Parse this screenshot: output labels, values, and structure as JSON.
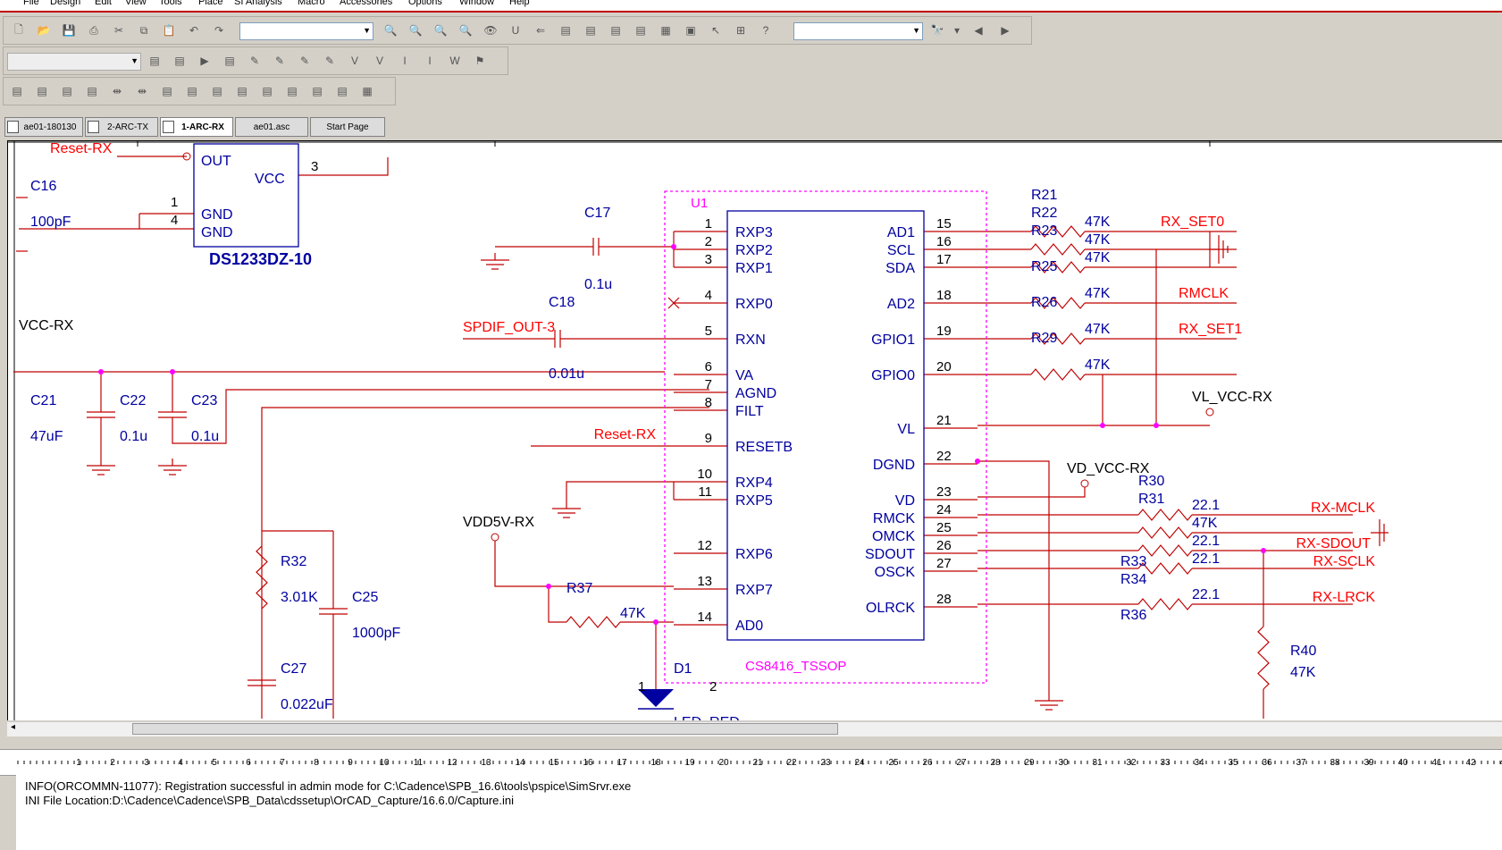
{
  "menu": [
    "File",
    "Design",
    "Edit",
    "View",
    "Tools",
    "Place",
    "SI Analysis",
    "Macro",
    "Accessories",
    "Options",
    "Window",
    "Help"
  ],
  "tabs": [
    {
      "label": "ae01-180130",
      "active": false
    },
    {
      "label": "2-ARC-TX",
      "active": false
    },
    {
      "label": "1-ARC-RX",
      "active": true
    },
    {
      "label": "ae01.asc",
      "active": false
    },
    {
      "label": "Start Page",
      "active": false
    }
  ],
  "toolbar": {
    "search_icon": "binoculars-icon",
    "help_icon": "help-icon"
  },
  "schematic": {
    "ic_u1": {
      "ref": "U1",
      "part": "CS8416_TSSOP",
      "left_pins": [
        [
          "1",
          "RXP3"
        ],
        [
          "2",
          "RXP2"
        ],
        [
          "3",
          "RXP1"
        ],
        [
          "4",
          "RXP0"
        ],
        [
          "5",
          "RXN"
        ],
        [
          "6",
          "VA"
        ],
        [
          "7",
          "AGND"
        ],
        [
          "8",
          "FILT"
        ],
        [
          "9",
          "RESETB"
        ],
        [
          "10",
          "RXP4"
        ],
        [
          "11",
          "RXP5"
        ],
        [
          "12",
          "RXP6"
        ],
        [
          "13",
          "RXP7"
        ],
        [
          "14",
          "AD0"
        ]
      ],
      "right_pins": [
        [
          "15",
          "AD1"
        ],
        [
          "16",
          "SCL"
        ],
        [
          "17",
          "SDA"
        ],
        [
          "18",
          "AD2"
        ],
        [
          "19",
          "GPIO1"
        ],
        [
          "20",
          "GPIO0"
        ],
        [
          "21",
          "VL"
        ],
        [
          "22",
          "DGND"
        ],
        [
          "23",
          "VD"
        ],
        [
          "24",
          "RMCK"
        ],
        [
          "25",
          "OMCK"
        ],
        [
          "26",
          "SDOUT"
        ],
        [
          "27",
          "OSCK"
        ],
        [
          "28",
          "OLRCK"
        ]
      ]
    },
    "ic_ds": {
      "part": "DS1233DZ-10",
      "pins": [
        "OUT",
        "VCC",
        "GND",
        "GND"
      ],
      "pin_nums": [
        "3",
        "1",
        "4"
      ]
    },
    "nets_red": [
      "Reset-RX",
      "SPDIF_OUT-3",
      "RX_SET0",
      "RMCLK",
      "RX_SET1",
      "RX-MCLK",
      "RX-SDOUT",
      "RX-SCLK",
      "RX-LRCK"
    ],
    "labels_black": [
      "VCC-RX",
      "VL_VCC-RX",
      "VD_VCC-RX",
      "VDD5V-RX"
    ],
    "components": {
      "C16": "100pF",
      "C17": "0.1u",
      "C18": "0.01u",
      "C21": "47uF",
      "C22": "0.1u",
      "C23": "0.1u",
      "R32": "3.01K",
      "C25": "1000pF",
      "C27": "0.022uF",
      "R37": "47K",
      "R40": "47K",
      "D1": "LED_RED"
    },
    "resistors_right": [
      "R21",
      "R22",
      "R23",
      "R25",
      "R26",
      "R29",
      "R30",
      "R31",
      "R33",
      "R34",
      "R36"
    ],
    "res_vals": [
      "47K",
      "47K",
      "47K",
      "47K",
      "47K",
      "47K",
      "47K",
      "22.1",
      "47K",
      "22.1",
      "22.1",
      "22.1"
    ]
  },
  "ruler_marks": [
    "1",
    "2",
    "3",
    "4",
    "5",
    "6",
    "7",
    "8",
    "9",
    "10",
    "11",
    "12",
    "13",
    "14",
    "15",
    "16",
    "17",
    "18",
    "19",
    "20",
    "21",
    "22",
    "23",
    "24",
    "25",
    "26",
    "27",
    "28",
    "29",
    "30",
    "31",
    "32",
    "33",
    "34",
    "35",
    "36",
    "37",
    "38",
    "39",
    "40",
    "41",
    "42",
    "43"
  ],
  "session_log": [
    "INFO(ORCOMMN-11077): Registration successful in admin mode for C:\\Cadence\\SPB_16.6\\tools\\pspice\\SimSrvr.exe",
    "INI File Location:D:\\Cadence\\Cadence\\SPB_Data\\cdssetup\\OrCAD_Capture/16.6.0/Capture.ini"
  ],
  "colors": {
    "wire": "#c00000",
    "part": "#0000a0",
    "refdes": "#ff00ff",
    "net": "#ff0000"
  }
}
